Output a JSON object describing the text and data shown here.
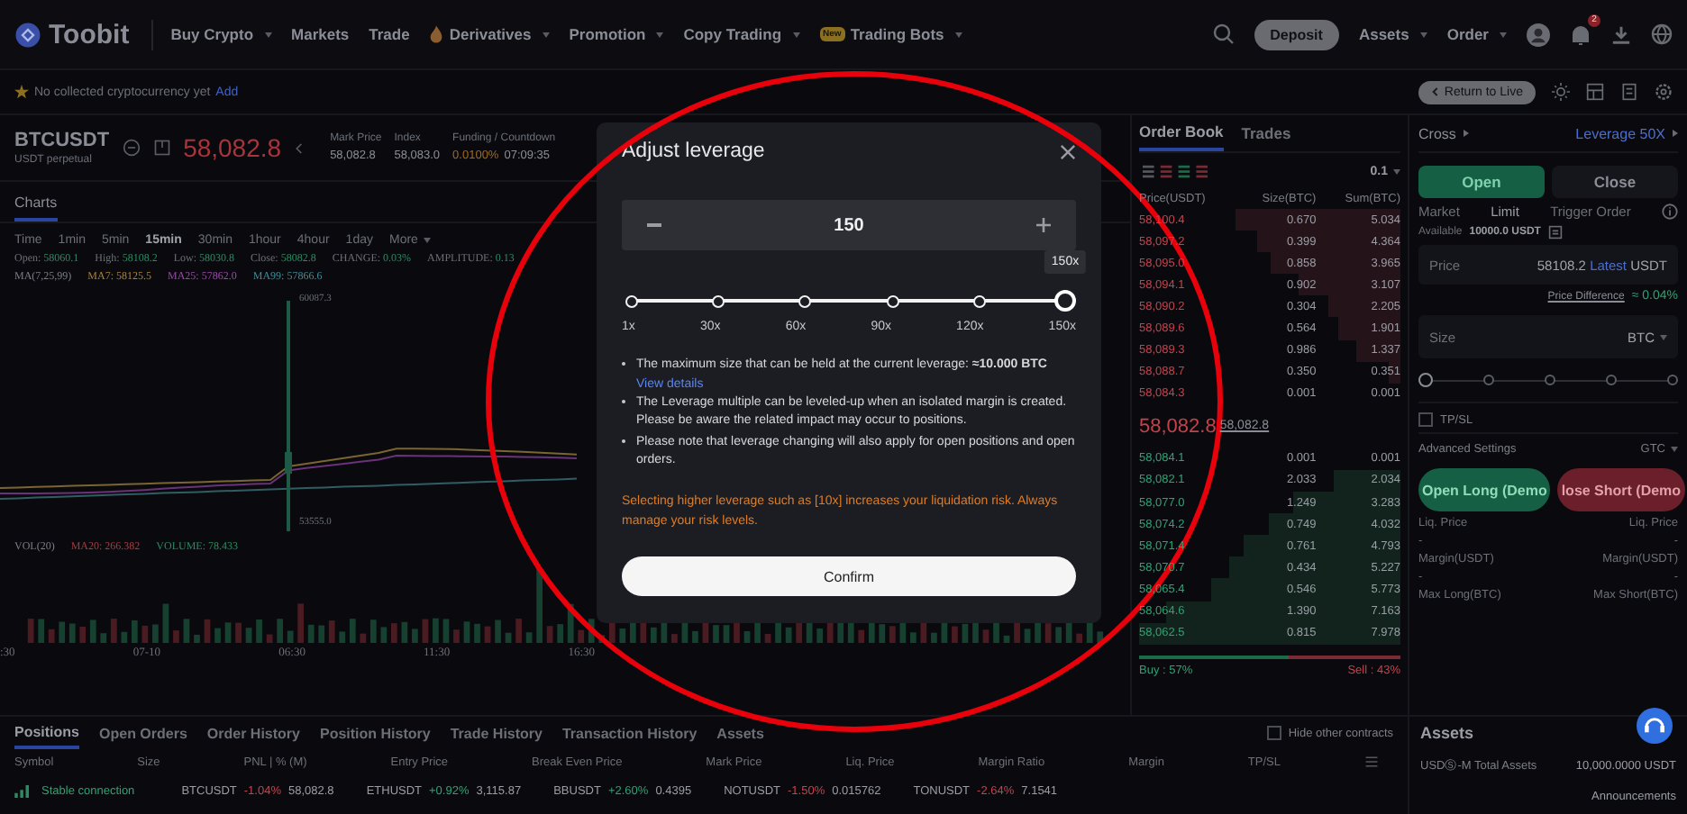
{
  "header": {
    "logo": "Toobit",
    "nav": [
      {
        "label": "Buy Crypto",
        "dropdown": true,
        "kind": "plain"
      },
      {
        "label": "Markets",
        "dropdown": false,
        "kind": "plain"
      },
      {
        "label": "Trade",
        "dropdown": false,
        "kind": "plain"
      },
      {
        "label": "Derivatives",
        "dropdown": true,
        "kind": "flame"
      },
      {
        "label": "Promotion",
        "dropdown": true,
        "kind": "plain"
      },
      {
        "label": "Copy Trading",
        "dropdown": true,
        "kind": "plain"
      },
      {
        "label": "Trading Bots",
        "dropdown": true,
        "kind": "badge",
        "badge": "New"
      }
    ],
    "deposit": "Deposit",
    "menus": [
      {
        "label": "Assets"
      },
      {
        "label": "Order"
      }
    ],
    "notification_count": "2"
  },
  "favorites": {
    "message": "No collected cryptocurrency yet",
    "link": "Add",
    "return_button": "Return to Live"
  },
  "ticker": {
    "symbol": "BTCUSDT",
    "subtitle": "USDT perpetual",
    "price": "58,082.8",
    "stats": [
      {
        "label": "Mark Price",
        "value": "58,082.8"
      },
      {
        "label": "Index",
        "value": "58,083.0"
      },
      {
        "label": "Funding / Countdown",
        "value": "0.0100%",
        "extra": "07:09:35"
      }
    ]
  },
  "chart": {
    "tab": "Charts",
    "intervals": [
      {
        "label": "Time",
        "selected": false
      },
      {
        "label": "1min",
        "selected": false
      },
      {
        "label": "5min",
        "selected": false
      },
      {
        "label": "15min",
        "selected": true
      },
      {
        "label": "30min",
        "selected": false
      },
      {
        "label": "1hour",
        "selected": false
      },
      {
        "label": "4hour",
        "selected": false
      },
      {
        "label": "1day",
        "selected": false
      }
    ],
    "more": "More",
    "legend": [
      {
        "label": "Open:",
        "value": "58060.1"
      },
      {
        "label": "High:",
        "value": "58108.2"
      },
      {
        "label": "Low:",
        "value": "58030.8"
      },
      {
        "label": "Close:",
        "value": "58082.8"
      },
      {
        "label": "CHANGE:",
        "value": "0.03%"
      },
      {
        "label": "AMPLITUDE:",
        "value": "0.13"
      }
    ],
    "ma_legend": [
      {
        "text": "MA(7,25,99)",
        "color": "#7c7f88"
      },
      {
        "text": "MA7: 58125.5",
        "color": "#a8843c"
      },
      {
        "text": "MA25: 57862.0",
        "color": "#9a4aaa"
      },
      {
        "text": "MA99: 57866.6",
        "color": "#3d8f9a"
      }
    ],
    "high_label": "60087.3",
    "low_label": "53555.0",
    "vol_legend": [
      {
        "text": "VOL(20)",
        "color": "#7c7f88"
      },
      {
        "text": "MA20: 266.382",
        "color": "#a83a40"
      },
      {
        "text": "VOLUME: 78.433",
        "color": "#2c8a62"
      }
    ],
    "x_labels": [
      ":30",
      "07-10",
      "06:30",
      "11:30",
      "16:30"
    ]
  },
  "orderbook": {
    "tabs": [
      {
        "label": "Order Book",
        "selected": true
      },
      {
        "label": "Trades",
        "selected": false
      }
    ],
    "precision": "0.1",
    "columns": [
      "Price(USDT)",
      "Size(BTC)",
      "Sum(BTC)"
    ],
    "asks": [
      {
        "price": "58,100.4",
        "size": "0.670",
        "sum": "5.034"
      },
      {
        "price": "58,097.2",
        "size": "0.399",
        "sum": "4.364"
      },
      {
        "price": "58,095.0",
        "size": "0.858",
        "sum": "3.965"
      },
      {
        "price": "58,094.1",
        "size": "0.902",
        "sum": "3.107"
      },
      {
        "price": "58,090.2",
        "size": "0.304",
        "sum": "2.205"
      },
      {
        "price": "58,089.6",
        "size": "0.564",
        "sum": "1.901"
      },
      {
        "price": "58,089.3",
        "size": "0.986",
        "sum": "1.337"
      },
      {
        "price": "58,088.7",
        "size": "0.350",
        "sum": "0.351"
      },
      {
        "price": "58,084.3",
        "size": "0.001",
        "sum": "0.001"
      }
    ],
    "last_price": "58,082.8",
    "mark_price": "58,082.8",
    "bids": [
      {
        "price": "58,084.1",
        "size": "0.001",
        "sum": "0.001"
      },
      {
        "price": "58,082.1",
        "size": "2.033",
        "sum": "2.034"
      },
      {
        "price": "58,077.0",
        "size": "1.249",
        "sum": "3.283"
      },
      {
        "price": "58,074.2",
        "size": "0.749",
        "sum": "4.032"
      },
      {
        "price": "58,071.4",
        "size": "0.761",
        "sum": "4.793"
      },
      {
        "price": "58,070.7",
        "size": "0.434",
        "sum": "5.227"
      },
      {
        "price": "58,065.4",
        "size": "0.546",
        "sum": "5.773"
      },
      {
        "price": "58,064.6",
        "size": "1.390",
        "sum": "7.163"
      },
      {
        "price": "58,062.5",
        "size": "0.815",
        "sum": "7.978"
      }
    ],
    "pressure": {
      "buy": "Buy : 57%",
      "sell": "Sell : 43%",
      "level": 0.57
    }
  },
  "trade": {
    "margin_mode": "Cross",
    "leverage": "Leverage 50X",
    "sides": [
      {
        "label": "Open",
        "selected": true
      },
      {
        "label": "Close",
        "selected": false
      }
    ],
    "order_types": [
      {
        "label": "Market",
        "selected": false
      },
      {
        "label": "Limit",
        "selected": true
      },
      {
        "label": "Trigger Order",
        "selected": false
      }
    ],
    "available_label": "Available",
    "available": "10000.0 USDT",
    "price_field": {
      "label": "Price",
      "value": "58108.2",
      "latest": "Latest",
      "unit": "USDT"
    },
    "price_difference": "Price Difference",
    "difference": "≈ 0.04%",
    "size_field": {
      "placeholder": "Size",
      "unit": "BTC"
    },
    "size_slider": {
      "level": 0
    },
    "tpsl": {
      "label": "TP/SL",
      "checked": false
    },
    "advanced": "Advanced Settings",
    "tif": "GTC",
    "long_button": "Open Long (Demo",
    "short_button": "lose Short (Demo",
    "info": [
      {
        "left": "Liq. Price",
        "right": "Liq. Price"
      },
      {
        "left": "-",
        "right": "-"
      },
      {
        "left": "Margin(USDT)",
        "right": "Margin(USDT)"
      },
      {
        "left": "-",
        "right": "-"
      },
      {
        "left": "Max Long(BTC)",
        "right": "Max Short(BTC)"
      }
    ]
  },
  "bottom": {
    "tabs": [
      {
        "label": "Positions",
        "selected": true
      },
      {
        "label": "Open Orders",
        "selected": false
      },
      {
        "label": "Order History",
        "selected": false
      },
      {
        "label": "Position History",
        "selected": false
      },
      {
        "label": "Trade History",
        "selected": false
      },
      {
        "label": "Transaction History",
        "selected": false
      },
      {
        "label": "Assets",
        "selected": false
      }
    ],
    "hide_other": {
      "label": "Hide other contracts",
      "checked": false
    },
    "columns": [
      "Symbol",
      "Size",
      "PNL | % (M)",
      "Entry Price",
      "Break Even Price",
      "Mark Price",
      "Liq. Price",
      "Margin Ratio",
      "Margin",
      "TP/SL"
    ],
    "connection": "Stable connection",
    "tickers": [
      {
        "symbol": "BTCUSDT",
        "change": "-1.04%",
        "price": "58,082.8",
        "up": false
      },
      {
        "symbol": "ETHUSDT",
        "change": "+0.92%",
        "price": "3,115.87",
        "up": true
      },
      {
        "symbol": "BBUSDT",
        "change": "+2.60%",
        "price": "0.4395",
        "up": true
      },
      {
        "symbol": "NOTUSDT",
        "change": "-1.50%",
        "price": "0.015762",
        "up": false
      },
      {
        "symbol": "TONUSDT",
        "change": "-2.64%",
        "price": "7.1541",
        "up": false
      }
    ]
  },
  "assets": {
    "title": "Assets",
    "label": "USDⓈ-M Total Assets",
    "value": "10,000.0000 USDT",
    "announcements": "Announcements"
  },
  "modal": {
    "title": "Adjust leverage",
    "value": "150",
    "tooltip": "150x",
    "marks": [
      "1x",
      "30x",
      "60x",
      "90x",
      "120x",
      "150x"
    ],
    "level": 1,
    "notes": [
      {
        "text": "The maximum size that can be held at the current leverage:  **≈10.000 BTC**",
        "link": "View details"
      },
      {
        "text": "The Leverage multiple can be leveled-up when an isolated margin is created. Please be aware the related impact may occur to positions."
      },
      {
        "text": "Please note that leverage changing will also apply for open positions and open orders."
      }
    ],
    "warning": "Selecting higher leverage such as [10x] increases your liquidation risk. Always manage your risk levels.",
    "confirm": "Confirm"
  }
}
